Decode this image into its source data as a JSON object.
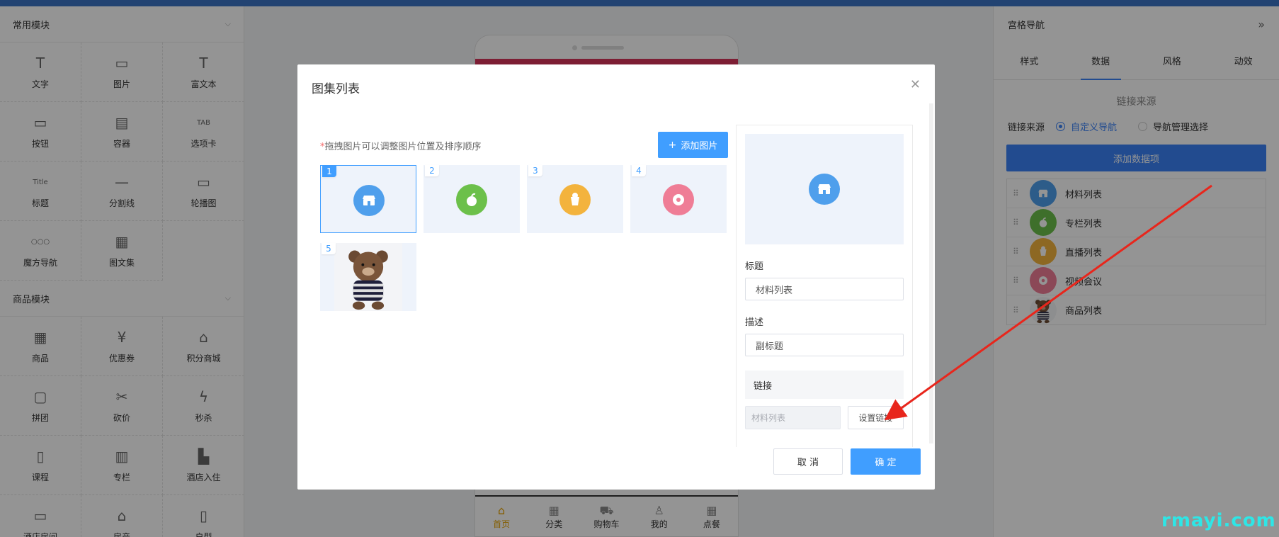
{
  "left": {
    "common": {
      "title": "常用模块",
      "items": [
        {
          "label": "文字",
          "icon": "T"
        },
        {
          "label": "图片",
          "icon": "▭"
        },
        {
          "label": "富文本",
          "icon": "T"
        },
        {
          "label": "按钮",
          "icon": "▭"
        },
        {
          "label": "容器",
          "icon": "▤"
        },
        {
          "label": "选项卡",
          "icon": "TAB"
        },
        {
          "label": "标题",
          "icon": "Title"
        },
        {
          "label": "分割线",
          "icon": "—"
        },
        {
          "label": "轮播图",
          "icon": "▭"
        },
        {
          "label": "魔方导航",
          "icon": "○○○"
        },
        {
          "label": "图文集",
          "icon": "▦"
        }
      ]
    },
    "goods": {
      "title": "商品模块",
      "items": [
        {
          "label": "商品",
          "icon": "▦"
        },
        {
          "label": "优惠券",
          "icon": "¥"
        },
        {
          "label": "积分商城",
          "icon": "⌂"
        },
        {
          "label": "拼团",
          "icon": "▢"
        },
        {
          "label": "砍价",
          "icon": "✂"
        },
        {
          "label": "秒杀",
          "icon": "ϟ"
        },
        {
          "label": "课程",
          "icon": "▯"
        },
        {
          "label": "专栏",
          "icon": "▥"
        },
        {
          "label": "酒店入住",
          "icon": "▙"
        },
        {
          "label": "酒店房间",
          "icon": "▭"
        },
        {
          "label": "房产",
          "icon": "⌂"
        },
        {
          "label": "户型",
          "icon": "▯"
        }
      ]
    }
  },
  "phone": {
    "tabs": [
      {
        "label": "首页",
        "icon": "⌂"
      },
      {
        "label": "分类",
        "icon": "▦"
      },
      {
        "label": "购物车",
        "icon": "⛟"
      },
      {
        "label": "我的",
        "icon": "♙"
      },
      {
        "label": "点餐",
        "icon": "▦"
      }
    ]
  },
  "right": {
    "title": "宫格导航",
    "tabs": [
      "样式",
      "数据",
      "风格",
      "动效"
    ],
    "active_tab": 1,
    "section_title": "链接来源",
    "source_label": "链接来源",
    "options": [
      "自定义导航",
      "导航管理选择"
    ],
    "add_button": "添加数据项",
    "items": [
      {
        "name": "材料列表",
        "color": "#4f9fec"
      },
      {
        "name": "专栏列表",
        "color": "#6cc04a"
      },
      {
        "name": "直播列表",
        "color": "#f3b33d"
      },
      {
        "name": "视频会议",
        "color": "#ef7d96"
      },
      {
        "name": "商品列表",
        "color": "bear"
      }
    ]
  },
  "modal": {
    "title": "图集列表",
    "hint_required": "*",
    "hint": "拖拽图片可以调整图片位置及排序顺序",
    "add_image": "添加图片",
    "add_image_icon": "+",
    "tiles": [
      {
        "num": "1",
        "color": "#4f9fec",
        "icon": "store"
      },
      {
        "num": "2",
        "color": "#6cc04a",
        "icon": "apple"
      },
      {
        "num": "3",
        "color": "#f3b33d",
        "icon": "cup"
      },
      {
        "num": "4",
        "color": "#ef7d96",
        "icon": "donut"
      },
      {
        "num": "5",
        "color": "bear",
        "icon": "bear"
      }
    ],
    "form": {
      "title_label": "标题",
      "title_value": "材料列表",
      "desc_label": "描述",
      "desc_value": "副标题",
      "link_label": "链接",
      "link_value": "材料列表",
      "set_link": "设置链接"
    },
    "cancel": "取 消",
    "confirm": "确 定"
  },
  "watermark": "rmayi.com"
}
